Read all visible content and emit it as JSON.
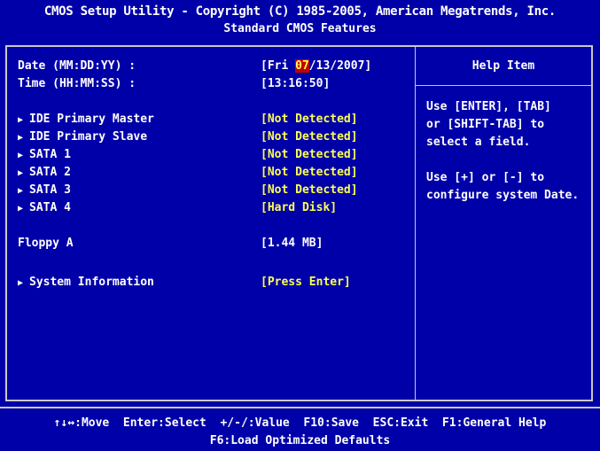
{
  "header": {
    "title": "CMOS Setup Utility - Copyright (C) 1985-2005, American Megatrends, Inc.",
    "subtitle": "Standard CMOS Features"
  },
  "settings": {
    "date": {
      "label": "Date (MM:DD:YY) :",
      "prefix": "[Fri ",
      "month": "07",
      "rest": "/13/2007]"
    },
    "time": {
      "label": "Time (HH:MM:SS) :",
      "value": "[13:16:50]"
    },
    "ide_primary_master": {
      "label": "IDE Primary Master",
      "value": "[Not Detected]"
    },
    "ide_primary_slave": {
      "label": "IDE Primary Slave",
      "value": "[Not Detected]"
    },
    "sata1": {
      "label": "SATA 1",
      "value": "[Not Detected]"
    },
    "sata2": {
      "label": "SATA 2",
      "value": "[Not Detected]"
    },
    "sata3": {
      "label": "SATA 3",
      "value": "[Not Detected]"
    },
    "sata4": {
      "label": "SATA 4",
      "value": "[Hard Disk]"
    },
    "floppy": {
      "label": "Floppy A",
      "value": "[1.44 MB]"
    },
    "system_info": {
      "label": "System Information",
      "value": "[Press Enter]"
    }
  },
  "help": {
    "title": "Help Item",
    "text": "Use [ENTER], [TAB]\nor [SHIFT-TAB] to\nselect a field.\n\nUse [+] or [-] to\nconfigure system Date."
  },
  "footer": {
    "line1": "↑↓↔:Move  Enter:Select  +/-/:Value  F10:Save  ESC:Exit  F1:General Help",
    "line2": "F6:Load Optimized Defaults"
  },
  "colors": {
    "background": "#0000a8",
    "value_text": "#ffff55",
    "highlight": "#c00000",
    "border": "#c8c8c8"
  }
}
